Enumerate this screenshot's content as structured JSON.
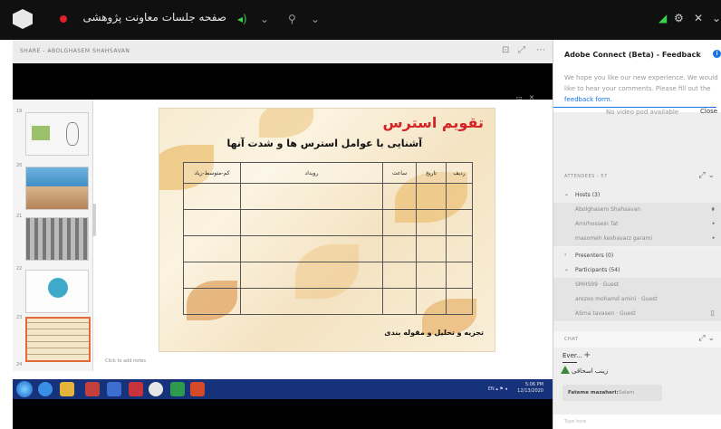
{
  "topbar": {
    "meeting_title": "صفحه جلسات معاونت پژوهشی",
    "mic_icon": "microphone-icon",
    "cam_icon": "webcam-icon",
    "controls": [
      "◂)",
      "⌄",
      "⚲",
      "⌄",
      "◢",
      "⚙",
      "✕",
      "⌄"
    ]
  },
  "share": {
    "title": "SHARE - ABOLGHASEM SHAHSAVAN",
    "notes": "Click to add notes",
    "thumb_numbers": [
      "19",
      "20",
      "21",
      "22",
      "23",
      "24"
    ]
  },
  "slide": {
    "title": "تقویم استرس",
    "subtitle": "آشنایی با عوامل استرس ها و شدت آنها",
    "columns": [
      "ردیف",
      "تاریخ",
      "ساعت",
      "رویداد",
      "کم-متوسط-زیاد"
    ],
    "footer": "تجزیه و تحلیل و مقوله بندی"
  },
  "taskbar": {
    "clock_time": "5:06 PM",
    "clock_date": "12/13/2020",
    "tray": "EN ▴ ⚑ ◂"
  },
  "feedback": {
    "title": "Adobe Connect (Beta) - Feedback",
    "text": "We hope you like our new experience. We would like to hear your comments. Please fill out the",
    "link": "feedback form.",
    "no_video": "No video pod available",
    "close": "Close"
  },
  "attendees": {
    "title": "ATTENDEES - 57",
    "hosts_label": "Hosts (3)",
    "hosts": [
      "Abolghasem Shahsavan",
      "Amirhossein Tat",
      "masomeh keshavarz garami"
    ],
    "presenters_label": "Presenters (0)",
    "participants_label": "Participants (54)",
    "participants": [
      "SMHS99 · Guest",
      "arezoo mohamd amini · Guest",
      "ASma tavasen · Guest"
    ]
  },
  "chat": {
    "title": "CHAT",
    "tab": "Ever...",
    "msg1": "زینب اسحاقی",
    "bubble_who": "Fateme mazaheri:",
    "bubble_msg": "Salam",
    "placeholder": "Type here"
  },
  "colors": {
    "accent_red": "#e0202a",
    "adobe_blue": "#1473e6",
    "slide_title_red": "#d42424",
    "taskbar_blue": "#15327a"
  }
}
